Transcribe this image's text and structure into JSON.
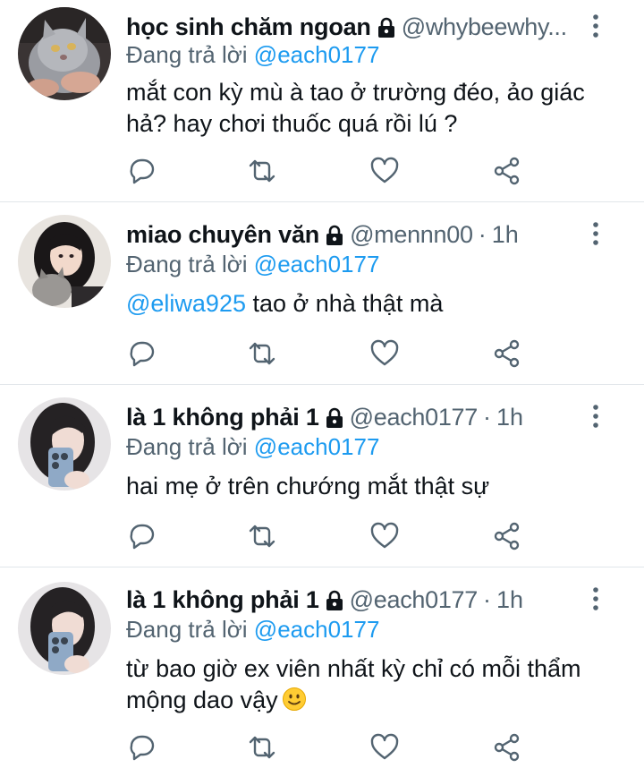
{
  "tweets": [
    {
      "display_name": "học sinh chăm ngoan",
      "handle": "@whybeewhy...",
      "time": "",
      "replying_label": "Đang trả lời",
      "replying_to": "@each0177",
      "mention": "",
      "text": "mắt con kỳ mù à tao ở trường đéo, ảo giác hả? hay chơi thuốc quá rồi lú ?",
      "avatar": "cat-avatar"
    },
    {
      "display_name": "miao chuyên văn",
      "handle": "@mennn00",
      "separator": "·",
      "time": "1h",
      "replying_label": "Đang trả lời",
      "replying_to": "@each0177",
      "mention": "@eliwa925",
      "text": " tao ở nhà thật mà",
      "avatar": "girl-cat-avatar"
    },
    {
      "display_name": "là 1 không phải 1",
      "handle": "@each0177",
      "separator": "·",
      "time": "1h",
      "replying_label": "Đang trả lời",
      "replying_to": "@each0177",
      "mention": "",
      "text": "hai mẹ ở trên chướng mắt thật sự",
      "avatar": "selfie-avatar"
    },
    {
      "display_name": "là 1 không phải 1",
      "handle": "@each0177",
      "separator": "·",
      "time": "1h",
      "replying_label": "Đang trả lời",
      "replying_to": "@each0177",
      "mention": "",
      "text": "từ bao giờ ex viên nhất kỳ chỉ có mỗi thẩm mộng dao vậy",
      "emoji": "slightly-smiling-face",
      "avatar": "selfie-avatar"
    }
  ],
  "icons": {
    "lock": "lock-icon",
    "more": "more-vertical-icon",
    "reply": "reply-icon",
    "retweet": "retweet-icon",
    "like": "heart-icon",
    "share": "share-icon"
  },
  "colors": {
    "text": "#0f1419",
    "secondary": "#536471",
    "accent": "#1d9bf0",
    "divider": "#e1e6ea"
  }
}
